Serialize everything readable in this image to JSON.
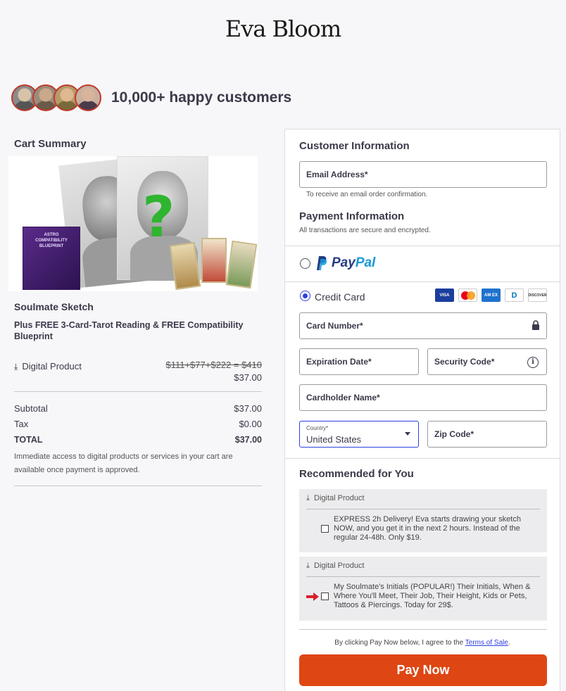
{
  "brand": {
    "name": "Eva Bloom"
  },
  "social_proof": {
    "text": "10,000+ happy customers",
    "avatar_count": 4
  },
  "cart": {
    "title": "Cart Summary",
    "book_title": "ASTRO COMPATIBILITY BLUEPRINT",
    "question_mark": "?",
    "product_name": "Soulmate Sketch",
    "product_sub": "Plus FREE 3-Card-Tarot Reading & FREE Compatibility Blueprint",
    "digital_label": "Digital Product",
    "strike_price": "$111+$77+$222 = $410",
    "price": "$37.00",
    "subtotal_label": "Subtotal",
    "subtotal": "$37.00",
    "tax_label": "Tax",
    "tax": "$0.00",
    "total_label": "TOTAL",
    "total": "$37.00",
    "notice": "Immediate access to digital products or services in your cart are available once payment is approved."
  },
  "customer": {
    "title": "Customer Information",
    "email_label": "Email Address*",
    "email_hint": "To receive an email order confirmation."
  },
  "payment": {
    "title": "Payment Information",
    "secure_note": "All transactions are secure and encrypted.",
    "paypal_word_a": "Pay",
    "paypal_word_b": "Pal",
    "credit_label": "Credit Card",
    "selected_method": "credit",
    "card_brands": {
      "visa": "VISA",
      "amex": "AM EX",
      "diners": "D",
      "discover": "DISCOVER"
    },
    "card_number_label": "Card Number*",
    "expiration_label": "Expiration Date*",
    "security_label": "Security Code*",
    "info_glyph": "i",
    "cardholder_label": "Cardholder Name*",
    "country_mini": "Country*",
    "country_value": "United States",
    "zip_label": "Zip Code*"
  },
  "recommended": {
    "title": "Recommended for You",
    "items": [
      {
        "header": "Digital Product",
        "text": "EXPRESS 2h Delivery! Eva starts drawing your sketch NOW, and you get it in the next 2 hours. Instead of the regular 24-48h. Only $19.",
        "checked": false
      },
      {
        "header": "Digital Product",
        "text": "My Soulmate's Initials (POPULAR!) Their Initials, When & Where You'll Meet, Their Job, Their Height, Kids or Pets, Tattoos & Piercings. Today for 29$.",
        "checked": false
      }
    ]
  },
  "agree": {
    "text": "By clicking Pay Now below, I agree to the",
    "link": "Terms of Sale",
    "end": "."
  },
  "pay_button": {
    "label": "Pay Now",
    "color": "#de4613"
  },
  "download_glyph": "⤓",
  "colors": {
    "accent": "#2d3fe0",
    "paypal_dark": "#253b80",
    "paypal_light": "#179bd7"
  }
}
